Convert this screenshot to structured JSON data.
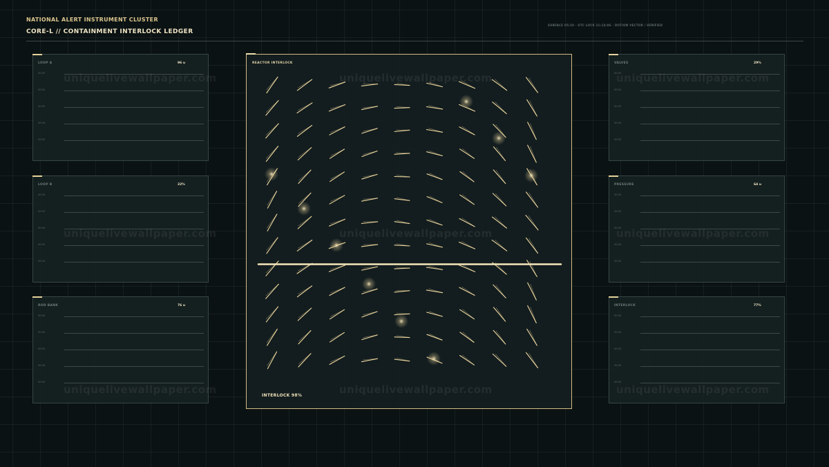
{
  "header": {
    "brand": "NATIONAL ALERT INSTRUMENT CLUSTER",
    "title": "CORE-L  //  CONTAINMENT INTERLOCK LEDGER",
    "meta": "SUBFACE 05/10 · UTC LOCK 21:14:06 · DOTION VECTOR / VERIFIED"
  },
  "panels": [
    {
      "title": "LOOP A",
      "value": "96 u",
      "ticks": [
        "00:00",
        "00:00",
        "00:00",
        "00:00",
        "00:00"
      ]
    },
    {
      "title": "LOOP B",
      "value": "22%",
      "ticks": [
        "00:00",
        "00:00",
        "00:00",
        "00:00",
        "00:00"
      ]
    },
    {
      "title": "ROD BANK",
      "value": "76 u",
      "ticks": [
        "00:00",
        "00:00",
        "00:00",
        "00:00",
        "00:00"
      ]
    },
    {
      "title": "VALVES",
      "value": "29%",
      "ticks": [
        "00:00",
        "00:00",
        "00:00",
        "00:00",
        "00:00"
      ]
    },
    {
      "title": "PRESSURE",
      "value": "64 u",
      "ticks": [
        "00:00",
        "00:00",
        "00:00",
        "00:00",
        "00:00"
      ]
    },
    {
      "title": "INTERLOCK",
      "value": "77%",
      "ticks": [
        "00:00",
        "00:00",
        "00:00",
        "00:00",
        "00:00"
      ]
    }
  ],
  "center": {
    "title": "REACTOR INTERLOCK",
    "footer": "INTERLOCK 98%",
    "accent": "#f0d9a0",
    "interlock_level": 0.55
  },
  "watermark": "uniquelivewallpaper.com"
}
